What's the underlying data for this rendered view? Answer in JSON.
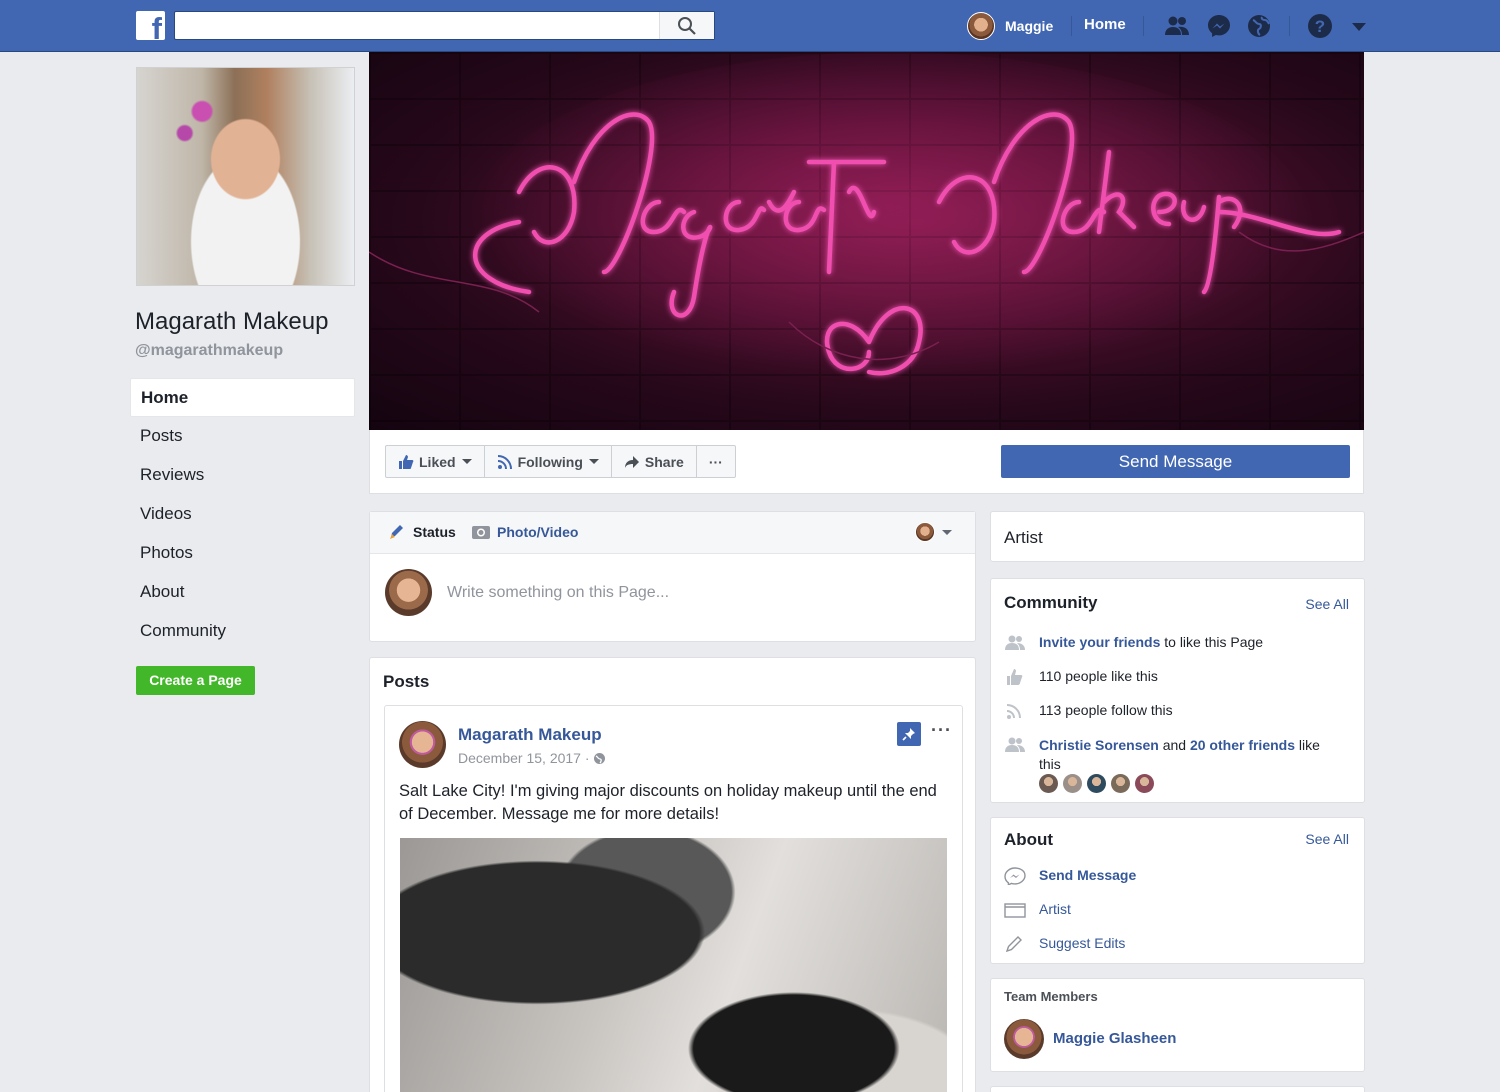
{
  "topbar": {
    "logo": "f",
    "user_name": "Maggie",
    "home_label": "Home",
    "icons": [
      "friend-requests-icon",
      "messenger-icon",
      "notifications-globe-icon",
      "help-icon",
      "account-menu-caret-icon"
    ]
  },
  "page": {
    "name": "Magarath Makeup",
    "handle": "@magarathmakeup"
  },
  "leftnav": {
    "items": [
      {
        "label": "Home"
      },
      {
        "label": "Posts"
      },
      {
        "label": "Reviews"
      },
      {
        "label": "Videos"
      },
      {
        "label": "Photos"
      },
      {
        "label": "About"
      },
      {
        "label": "Community"
      }
    ],
    "create_page": "Create a Page"
  },
  "actions": {
    "liked": "Liked",
    "following": "Following",
    "share": "Share",
    "more": "···",
    "send_message": "Send Message"
  },
  "composer": {
    "status_tab": "Status",
    "photo_tab": "Photo/Video",
    "placeholder": "Write something on this Page..."
  },
  "posts": {
    "title": "Posts",
    "post": {
      "author": "Magarath Makeup",
      "date": "December 15, 2017 ·",
      "text": "Salt Lake City! I'm giving major discounts on holiday makeup until the end of December. Message me for more details!",
      "more": "···"
    }
  },
  "sidebar": {
    "category": "Artist",
    "community": {
      "title": "Community",
      "see_all": "See All",
      "invite_link": "Invite your friends",
      "invite_rest": "to like this Page",
      "likes": "110 people like this",
      "follows": "113 people follow this",
      "friend_name": "Christie Sorensen",
      "friend_and": "and",
      "friend_others": "20 other friends",
      "friend_rest": "like this",
      "friend_colors": [
        "#6b5a52",
        "#9a8f89",
        "#2e4a5e",
        "#7a6a5a",
        "#8a4a5a"
      ]
    },
    "about": {
      "title": "About",
      "see_all": "See All",
      "send_message": "Send Message",
      "category": "Artist",
      "suggest_edits": "Suggest Edits"
    },
    "team": {
      "title": "Team Members",
      "member": "Maggie Glasheen"
    }
  },
  "colors": {
    "brand": "#4267b2",
    "link": "#365899",
    "create_green": "#42b72a"
  }
}
